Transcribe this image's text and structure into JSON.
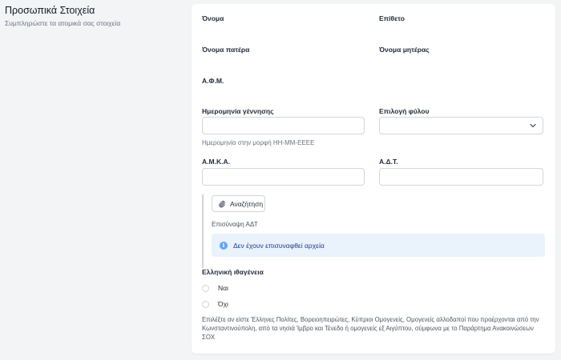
{
  "section": {
    "title": "Προσωπικά Στοιχεία",
    "subtitle": "Συμπληρώστε τα ατομικά σας στοιχεία"
  },
  "fields": {
    "first_name_label": "Όνομα",
    "last_name_label": "Επίθετο",
    "father_name_label": "Όνομα πατέρα",
    "mother_name_label": "Όνομα μητέρας",
    "afm_label": "Α.Φ.Μ.",
    "birth_date_label": "Ημερομηνία γέννησης",
    "birth_date_value": "",
    "birth_date_hint": "Ημερομηνία στην μορφή ΗΗ-ΜΜ-ΕΕΕΕ",
    "gender_label": "Επιλογή φύλου",
    "gender_value": "",
    "amka_label": "Α.Μ.Κ.Α.",
    "amka_value": "",
    "adt_label": "Α.Δ.Τ.",
    "adt_value": ""
  },
  "upload": {
    "button_label": "Αναζήτηση",
    "label": "Επισύναψη ΑΔΤ",
    "empty_message": "Δεν έχουν επισυναφθεί αρχεία"
  },
  "nationality": {
    "label": "Ελληνική ιθαγένεια",
    "options": [
      "Ναι",
      "Όχι"
    ],
    "description": "Επιλέξτε αν είστε Έλληνες Πολίτες, Βορειοηπειρώτες, Κύπριοι Ομογενείς, Ομογενείς αλλοδαποί που προέρχονται από την Κωνσταντινούπολη, από τα νησιά Ίμβρο και Τένεδο ή ομογενείς εξ Αιγύπτου, σύμφωνα με το Παράρτημα Ανακοινώσεων ΣΟΧ"
  },
  "icons": {
    "attach": "paperclip-icon",
    "info": "info-icon",
    "select": "chevron-down-icon"
  },
  "colors": {
    "info_bg": "#eaf2fb",
    "info_icon": "#60a5fa",
    "info_text": "#1e3a8a"
  }
}
